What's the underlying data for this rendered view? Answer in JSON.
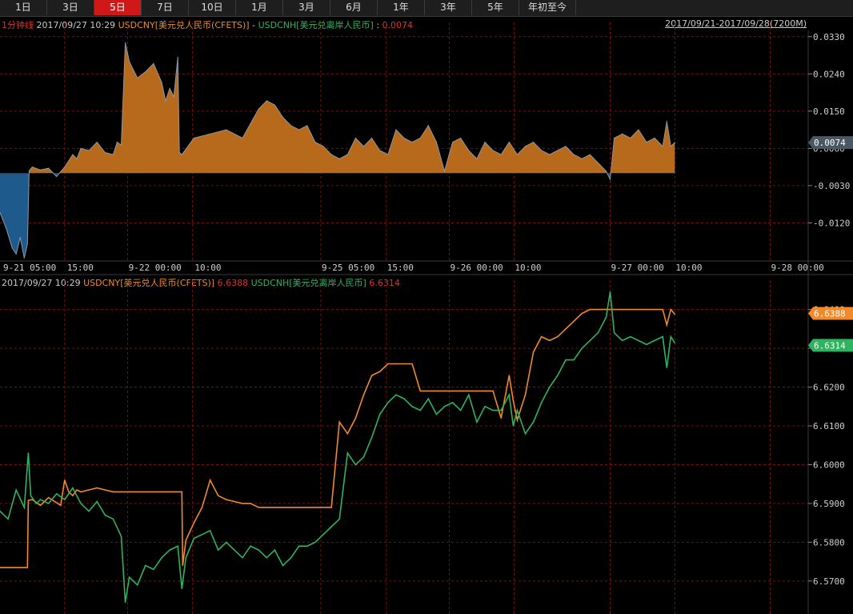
{
  "toolbar": {
    "tabs": [
      "1日",
      "3日",
      "5日",
      "7日",
      "10日",
      "1月",
      "3月",
      "6月",
      "1年",
      "3年",
      "5年",
      "年初至今"
    ],
    "active": "5日"
  },
  "top_info": {
    "interval": "1分钟线",
    "datetime": "2017/09/27 10:29",
    "series_a": "USDCNY[美元兑人民币(CFETS)]",
    "separator": "-",
    "series_b": "USDCNH[美元兑离岸人民币]",
    "colon": ":",
    "value": "0.0074",
    "range": "2017/09/21-2017/09/28(7200M)"
  },
  "bottom_info": {
    "datetime": "2017/09/27 10:29",
    "series_a": "USDCNY[美元兑人民币(CFETS)]",
    "value_a": "6.6388",
    "series_b": "USDCNH[美元兑离岸人民币]",
    "value_b": "6.6314"
  },
  "x_labels": [
    "9-21 05:00",
    "15:00",
    "9-22 00:00",
    "10:00",
    "9-25 05:00",
    "15:00",
    "9-26 00:00",
    "10:00",
    "9-27 00:00",
    "10:00",
    "9-28 00:00"
  ],
  "colors": {
    "cny": "#f08a2a",
    "cnh": "#2fb35e",
    "spread_pos": "#b86a1c",
    "spread_neg": "#1e5a8c",
    "spread_line": "#8a97a8",
    "grid": "#6e1515",
    "tag": "#4a5866"
  },
  "chart_data": [
    {
      "type": "area",
      "title": "USDCNY[美元兑人民币(CFETS)] - USDCNH[美元兑离岸人民币]",
      "ylim": [
        -0.021,
        0.0345
      ],
      "y_ticks": [
        "0.0330",
        "0.0240",
        "0.0150",
        "0.0060",
        "-0.0030",
        "-0.0120"
      ],
      "last_value_label": "0.0074",
      "series": [
        {
          "name": "spread",
          "x": [
            0,
            0.003,
            0.008,
            0.015,
            0.02,
            0.025,
            0.03,
            0.034,
            0.036,
            0.04,
            0.05,
            0.06,
            0.07,
            0.08,
            0.09,
            0.095,
            0.1,
            0.11,
            0.12,
            0.13,
            0.14,
            0.145,
            0.15,
            0.155,
            0.16,
            0.17,
            0.18,
            0.19,
            0.2,
            0.205,
            0.21,
            0.215,
            0.22,
            0.222,
            0.225,
            0.24,
            0.26,
            0.28,
            0.3,
            0.31,
            0.32,
            0.33,
            0.34,
            0.35,
            0.36,
            0.37,
            0.38,
            0.39,
            0.4,
            0.41,
            0.42,
            0.43,
            0.44,
            0.45,
            0.46,
            0.47,
            0.48,
            0.49,
            0.5,
            0.51,
            0.52,
            0.53,
            0.54,
            0.55,
            0.56,
            0.57,
            0.58,
            0.59,
            0.6,
            0.61,
            0.62,
            0.63,
            0.64,
            0.65,
            0.66,
            0.67,
            0.68,
            0.69,
            0.7,
            0.71,
            0.72,
            0.73,
            0.74,
            0.75,
            0.755,
            0.76,
            0.77,
            0.78,
            0.79,
            0.8,
            0.81,
            0.82,
            0.825,
            0.83,
            0.835
          ],
          "values": [
            -0.0095,
            -0.011,
            -0.0135,
            -0.018,
            -0.0195,
            -0.0155,
            -0.0205,
            -0.017,
            0.0006,
            0.0015,
            0.0008,
            0.0012,
            -0.0008,
            0.0015,
            0.0045,
            0.0035,
            0.006,
            0.0055,
            0.0075,
            0.005,
            0.0045,
            0.0075,
            0.0068,
            0.0315,
            0.027,
            0.023,
            0.0245,
            0.0265,
            0.022,
            0.0175,
            0.0205,
            0.0185,
            0.028,
            0.005,
            0.0045,
            0.0085,
            0.0095,
            0.0105,
            0.0085,
            0.012,
            0.0155,
            0.0175,
            0.0165,
            0.0135,
            0.0115,
            0.0105,
            0.0115,
            0.0075,
            0.0065,
            0.0045,
            0.0035,
            0.0045,
            0.0085,
            0.0065,
            0.0085,
            0.0055,
            0.0045,
            0.0105,
            0.0085,
            0.0075,
            0.0085,
            0.0115,
            0.0075,
            0.0005,
            0.0075,
            0.0085,
            0.0055,
            0.0035,
            0.0075,
            0.0055,
            0.0045,
            0.0075,
            0.0045,
            0.0065,
            0.0075,
            0.0055,
            0.0045,
            0.0055,
            0.0065,
            0.0045,
            0.0035,
            0.0045,
            0.0025,
            0.0005,
            -0.0015,
            0.0085,
            0.0095,
            0.0085,
            0.0105,
            0.0075,
            0.0085,
            0.0065,
            0.0125,
            0.0065,
            0.0074
          ]
        }
      ]
    },
    {
      "type": "line",
      "title": "",
      "ylim": [
        6.5615,
        6.6455
      ],
      "y_ticks": [
        "6.6400",
        "6.6300",
        "6.6200",
        "6.6100",
        "6.6000",
        "6.5900",
        "6.5800",
        "6.5700"
      ],
      "last_value_labels": [
        "6.6388",
        "6.6314"
      ],
      "series": [
        {
          "name": "USDCNY[美元兑人民币(CFETS)]",
          "x": [
            0,
            0.034,
            0.035,
            0.04,
            0.05,
            0.06,
            0.07,
            0.075,
            0.08,
            0.085,
            0.09,
            0.095,
            0.1,
            0.11,
            0.12,
            0.13,
            0.14,
            0.145,
            0.15,
            0.16,
            0.17,
            0.18,
            0.19,
            0.2,
            0.21,
            0.22,
            0.225,
            0.226,
            0.23,
            0.24,
            0.25,
            0.26,
            0.27,
            0.28,
            0.29,
            0.3,
            0.31,
            0.32,
            0.33,
            0.34,
            0.35,
            0.36,
            0.37,
            0.38,
            0.39,
            0.4,
            0.41,
            0.42,
            0.43,
            0.44,
            0.45,
            0.46,
            0.47,
            0.48,
            0.49,
            0.5,
            0.51,
            0.52,
            0.53,
            0.54,
            0.55,
            0.56,
            0.57,
            0.58,
            0.59,
            0.6,
            0.61,
            0.62,
            0.63,
            0.635,
            0.64,
            0.65,
            0.66,
            0.67,
            0.68,
            0.69,
            0.7,
            0.71,
            0.72,
            0.73,
            0.74,
            0.75,
            0.76,
            0.77,
            0.78,
            0.79,
            0.8,
            0.81,
            0.82,
            0.825,
            0.83,
            0.835
          ],
          "values": [
            6.5735,
            6.5735,
            6.5908,
            6.591,
            6.5895,
            6.5915,
            6.5902,
            6.5895,
            6.596,
            6.593,
            6.592,
            6.5935,
            6.593,
            6.5935,
            6.594,
            6.5935,
            6.593,
            6.593,
            6.593,
            6.593,
            6.593,
            6.593,
            6.593,
            6.593,
            6.593,
            6.593,
            6.593,
            6.574,
            6.5805,
            6.585,
            6.589,
            6.596,
            6.592,
            6.591,
            6.5905,
            6.59,
            6.59,
            6.589,
            6.589,
            6.589,
            6.589,
            6.589,
            6.589,
            6.589,
            6.589,
            6.589,
            6.589,
            6.611,
            6.608,
            6.612,
            6.618,
            6.623,
            6.624,
            6.626,
            6.626,
            6.626,
            6.626,
            6.619,
            6.619,
            6.619,
            6.619,
            6.619,
            6.619,
            6.619,
            6.619,
            6.619,
            6.619,
            6.612,
            6.623,
            6.6165,
            6.6115,
            6.618,
            6.629,
            6.633,
            6.632,
            6.633,
            6.635,
            6.637,
            6.639,
            6.64,
            6.64,
            6.64,
            6.64,
            6.64,
            6.64,
            6.64,
            6.64,
            6.64,
            6.64,
            6.636,
            6.64,
            6.6388
          ]
        },
        {
          "name": "USDCNH[美元兑离岸人民币]",
          "x": [
            0,
            0.01,
            0.02,
            0.03,
            0.035,
            0.038,
            0.045,
            0.05,
            0.06,
            0.07,
            0.08,
            0.09,
            0.1,
            0.11,
            0.12,
            0.13,
            0.14,
            0.15,
            0.155,
            0.16,
            0.17,
            0.18,
            0.19,
            0.2,
            0.21,
            0.22,
            0.225,
            0.23,
            0.24,
            0.25,
            0.26,
            0.27,
            0.28,
            0.29,
            0.3,
            0.31,
            0.32,
            0.33,
            0.34,
            0.35,
            0.36,
            0.37,
            0.38,
            0.39,
            0.4,
            0.41,
            0.42,
            0.43,
            0.44,
            0.45,
            0.46,
            0.47,
            0.48,
            0.49,
            0.5,
            0.51,
            0.52,
            0.53,
            0.54,
            0.55,
            0.56,
            0.57,
            0.58,
            0.59,
            0.6,
            0.61,
            0.62,
            0.63,
            0.635,
            0.64,
            0.65,
            0.66,
            0.67,
            0.68,
            0.69,
            0.7,
            0.71,
            0.72,
            0.73,
            0.74,
            0.75,
            0.755,
            0.76,
            0.77,
            0.78,
            0.79,
            0.8,
            0.81,
            0.82,
            0.825,
            0.83,
            0.835
          ],
          "values": [
            6.588,
            6.586,
            6.5935,
            6.589,
            6.603,
            6.592,
            6.59,
            6.591,
            6.59,
            6.5925,
            6.591,
            6.594,
            6.59,
            6.588,
            6.5905,
            6.587,
            6.586,
            6.5815,
            6.5645,
            6.571,
            6.569,
            6.574,
            6.573,
            6.576,
            6.578,
            6.579,
            6.568,
            6.576,
            6.581,
            6.582,
            6.583,
            6.578,
            6.58,
            6.578,
            6.576,
            6.579,
            6.578,
            6.576,
            6.578,
            6.574,
            6.576,
            6.579,
            6.579,
            6.58,
            6.582,
            6.584,
            6.586,
            6.603,
            6.6,
            6.602,
            6.607,
            6.613,
            6.616,
            6.618,
            6.617,
            6.615,
            6.614,
            6.617,
            6.613,
            6.615,
            6.616,
            6.614,
            6.618,
            6.611,
            6.615,
            6.614,
            6.614,
            6.618,
            6.61,
            6.614,
            6.608,
            6.611,
            6.616,
            6.62,
            6.623,
            6.627,
            6.627,
            6.63,
            6.632,
            6.634,
            6.638,
            6.6445,
            6.634,
            6.632,
            6.633,
            6.632,
            6.631,
            6.632,
            6.633,
            6.625,
            6.633,
            6.6314
          ]
        }
      ]
    }
  ]
}
